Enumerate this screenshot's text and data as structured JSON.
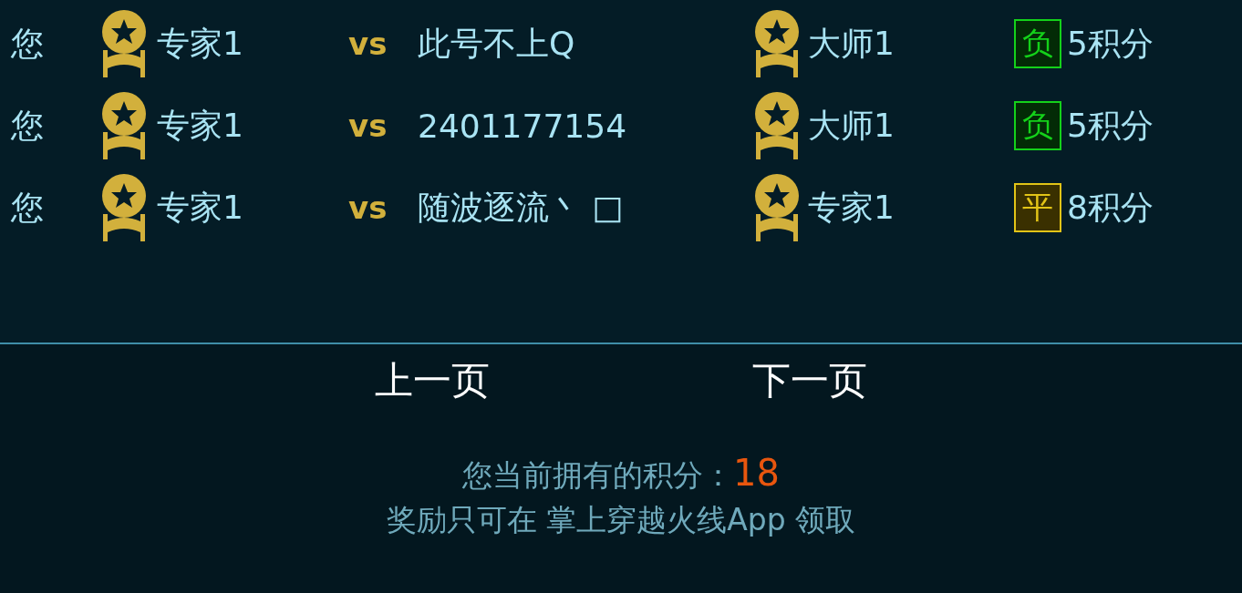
{
  "matches": [
    {
      "you": "您",
      "your_rank": "专家1",
      "vs": "vs",
      "opponent": "此号不上Q",
      "opponent_rank": "大师1",
      "result": {
        "kind": "loss",
        "label": "负"
      },
      "points": "5积分"
    },
    {
      "you": "您",
      "your_rank": "专家1",
      "vs": "vs",
      "opponent": "2401177154",
      "opponent_rank": "大师1",
      "result": {
        "kind": "loss",
        "label": "负"
      },
      "points": "5积分"
    },
    {
      "you": "您",
      "your_rank": "专家1",
      "vs": "vs",
      "opponent": "随波逐流丶 □",
      "opponent_rank": "专家1",
      "result": {
        "kind": "draw",
        "label": "平"
      },
      "points": "8积分"
    }
  ],
  "pager": {
    "prev": "上一页",
    "next": "下一页"
  },
  "summary": {
    "label": "您当前拥有的积分：",
    "value": "18",
    "note": "奖励只可在 掌上穿越火线App 领取"
  }
}
